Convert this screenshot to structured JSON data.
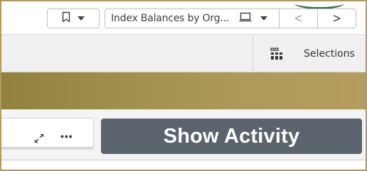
{
  "toolbar": {
    "bookmark_icon": "bookmark-icon",
    "sheet_title": "Index Balances by Org...",
    "sheet_icon": "laptop-icon",
    "prev_icon": "chevron-left-icon",
    "next_icon": "chevron-right-icon",
    "prev_glyph": "<",
    "next_glyph": ">"
  },
  "selections": {
    "label": "Selections",
    "icon": "selections-grid-icon"
  },
  "content": {
    "more_glyph": "•••",
    "expand_icon": "expand-icon",
    "show_activity_label": "Show Activity"
  },
  "colors": {
    "frame": "#b09a63",
    "banner_start": "#90823d",
    "banner_end": "#b49d5e",
    "button": "#5b646c",
    "accent_green": "#2f6f43"
  }
}
